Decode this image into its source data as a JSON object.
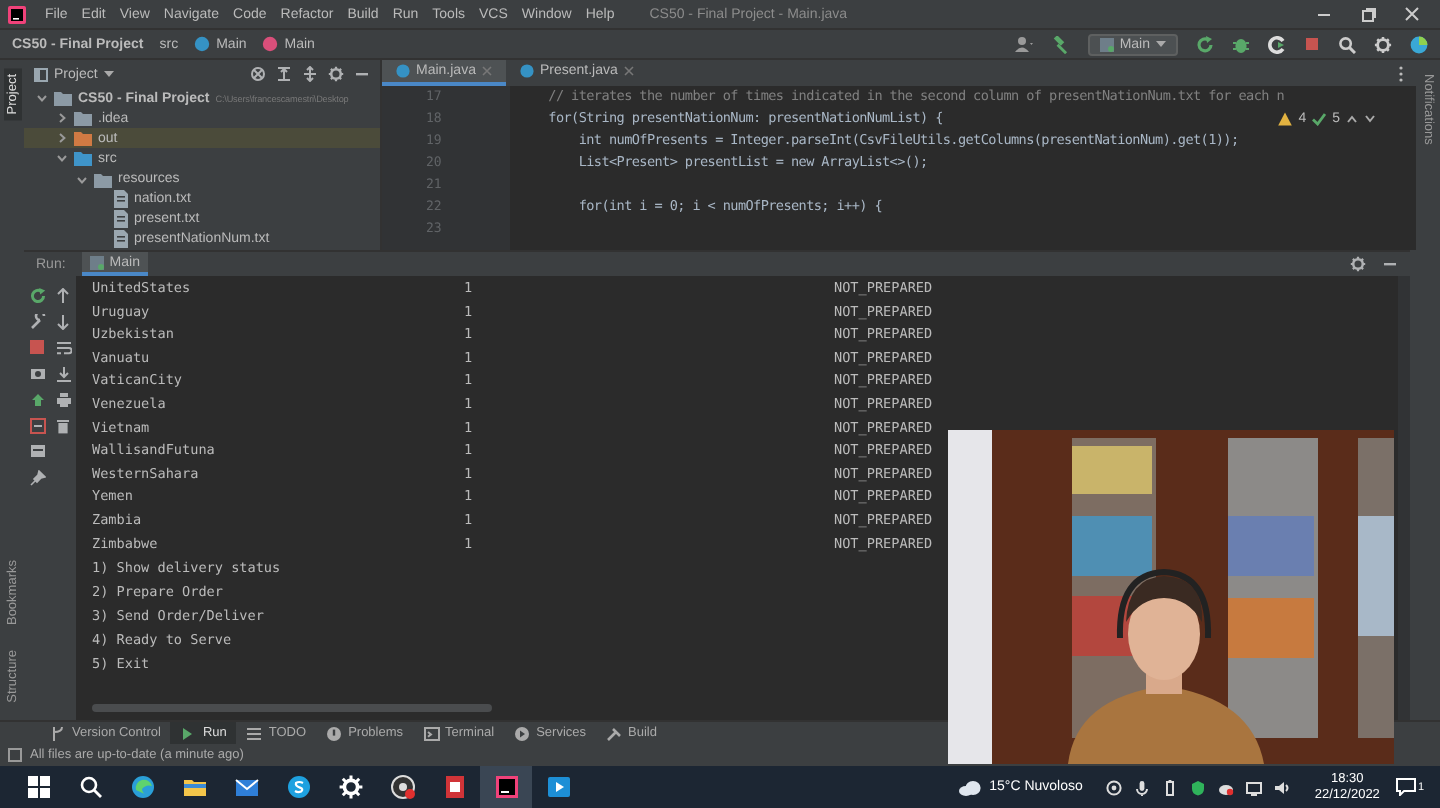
{
  "menu_bar": {
    "items": [
      "File",
      "Edit",
      "View",
      "Navigate",
      "Code",
      "Refactor",
      "Build",
      "Run",
      "Tools",
      "VCS",
      "Window",
      "Help"
    ],
    "title": "CS50 - Final Project - Main.java"
  },
  "nav_bar": {
    "breadcrumbs": [
      {
        "label": "CS50 - Final Project",
        "kind": "project"
      },
      {
        "label": "src",
        "kind": "folder"
      },
      {
        "label": "Main",
        "kind": "class"
      },
      {
        "label": "Main",
        "kind": "method"
      }
    ],
    "run_config": "Main"
  },
  "side_tabs": {
    "top": [
      {
        "label": "Project",
        "selected": true
      }
    ],
    "bottom": [
      {
        "label": "Bookmarks",
        "selected": false
      },
      {
        "label": "Structure",
        "selected": false
      }
    ],
    "right": [
      {
        "label": "Notifications",
        "selected": false
      }
    ]
  },
  "project_panel": {
    "title": "Project",
    "tree": [
      {
        "label": "CS50 - Final Project",
        "path": "C:\\Users\\francescamestri\\Desktop",
        "kind": "module",
        "expanded": true,
        "selected": false,
        "children": [
          {
            "label": ".idea",
            "kind": "folder",
            "expanded": false,
            "selected": false
          },
          {
            "label": "out",
            "kind": "excluded",
            "expanded": false,
            "selected": true
          },
          {
            "label": "src",
            "kind": "source",
            "expanded": true,
            "selected": false,
            "children": [
              {
                "label": "resources",
                "kind": "resources",
                "expanded": true,
                "selected": false,
                "children": [
                  {
                    "label": "nation.txt",
                    "kind": "file",
                    "selected": false
                  },
                  {
                    "label": "present.txt",
                    "kind": "file",
                    "selected": false
                  },
                  {
                    "label": "presentNationNum.txt",
                    "kind": "file",
                    "selected": false
                  }
                ]
              }
            ]
          }
        ]
      }
    ]
  },
  "editor": {
    "tabs": [
      {
        "label": "Main.java",
        "selected": true
      },
      {
        "label": "Present.java",
        "selected": false
      }
    ],
    "warnings": "4",
    "checks": "5",
    "lines": [
      {
        "number": "17",
        "kind": "comment",
        "code": "    // iterates the number of times indicated in the second column of presentNationNum.txt for each n"
      },
      {
        "number": "18",
        "kind": "code",
        "code": "    for(String presentNationNum: presentNationNumList) {"
      },
      {
        "number": "19",
        "kind": "code",
        "code": "        int numOfPresents = Integer.parseInt(CsvFileUtils.getColumns(presentNationNum).get(1));"
      },
      {
        "number": "20",
        "kind": "code",
        "code": "        List<Present> presentList = new ArrayList<>();"
      },
      {
        "number": "21",
        "kind": "code"
      },
      {
        "number": "22",
        "kind": "code",
        "code": "        for(int i = 0; i < numOfPresents; i++) {"
      },
      {
        "number": "23",
        "kind": "code"
      }
    ]
  },
  "run_panel": {
    "label": "Run:",
    "tabs": [
      {
        "label": "Main",
        "selected": true
      }
    ],
    "rows": [
      {
        "name": "UnitedStates",
        "count": "1",
        "status": "NOT_PREPARED"
      },
      {
        "name": "Uruguay",
        "count": "1",
        "status": "NOT_PREPARED"
      },
      {
        "name": "Uzbekistan",
        "count": "1",
        "status": "NOT_PREPARED"
      },
      {
        "name": "Vanuatu",
        "count": "1",
        "status": "NOT_PREPARED"
      },
      {
        "name": "VaticanCity",
        "count": "1",
        "status": "NOT_PREPARED"
      },
      {
        "name": "Venezuela",
        "count": "1",
        "status": "NOT_PREPARED"
      },
      {
        "name": "Vietnam",
        "count": "1",
        "status": "NOT_PREPARED"
      },
      {
        "name": "WallisandFutuna",
        "count": "1",
        "status": "NOT_PREPARED"
      },
      {
        "name": "WesternSahara",
        "count": "1",
        "status": "NOT_PREPARED"
      },
      {
        "name": "Yemen",
        "count": "1",
        "status": "NOT_PREPARED"
      },
      {
        "name": "Zambia",
        "count": "1",
        "status": "NOT_PREPARED"
      },
      {
        "name": "Zimbabwe",
        "count": "1",
        "status": "NOT_PREPARED"
      }
    ],
    "menu": [
      "1) Show delivery status",
      "2) Prepare Order",
      "3) Send Order/Deliver",
      "4) Ready to Serve",
      "5) Exit"
    ]
  },
  "tool_tabs": [
    {
      "label": "Version Control",
      "selected": false
    },
    {
      "label": "Run",
      "selected": true
    },
    {
      "label": "TODO",
      "selected": false
    },
    {
      "label": "Problems",
      "selected": false
    },
    {
      "label": "Terminal",
      "selected": false
    },
    {
      "label": "Services",
      "selected": false
    },
    {
      "label": "Build",
      "selected": false
    }
  ],
  "status_bar": "All files are up-to-date (a minute ago)",
  "taskbar": {
    "weather": "15°C Nuvoloso",
    "time": "18:30",
    "date": "22/12/2022",
    "notifications": "1"
  }
}
